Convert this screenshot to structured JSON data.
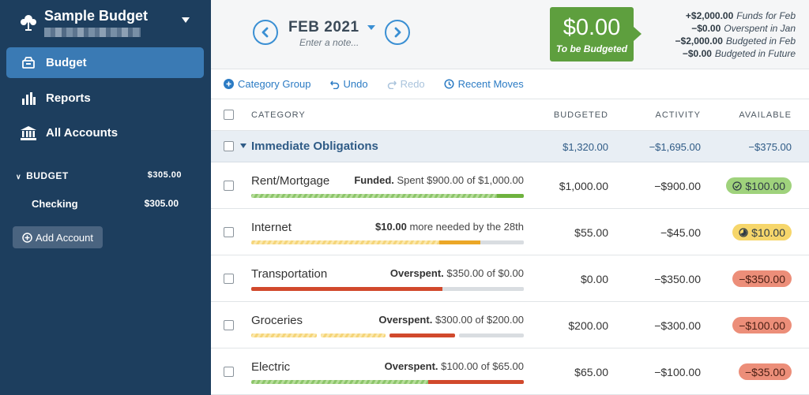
{
  "sidebar": {
    "budget_name": "Sample Budget",
    "nav": [
      {
        "label": "Budget",
        "icon": "budget-icon"
      },
      {
        "label": "Reports",
        "icon": "bar-chart-icon"
      },
      {
        "label": "All Accounts",
        "icon": "bank-icon"
      }
    ],
    "account_group": {
      "label": "BUDGET",
      "amount": "$305.00"
    },
    "accounts": [
      {
        "name": "Checking",
        "amount": "$305.00"
      }
    ],
    "add_account_label": "Add Account"
  },
  "header": {
    "month": "FEB 2021",
    "note_placeholder": "Enter a note...",
    "to_be_budgeted": {
      "amount": "$0.00",
      "label": "To be Budgeted"
    },
    "summary": [
      {
        "amount": "+$2,000.00",
        "label": "Funds for Feb"
      },
      {
        "amount": "−$0.00",
        "label": "Overspent in Jan"
      },
      {
        "amount": "−$2,000.00",
        "label": "Budgeted in Feb"
      },
      {
        "amount": "−$0.00",
        "label": "Budgeted in Future"
      }
    ]
  },
  "toolbar": {
    "category_group": "Category Group",
    "undo": "Undo",
    "redo": "Redo",
    "recent_moves": "Recent Moves"
  },
  "table": {
    "headers": {
      "category": "CATEGORY",
      "budgeted": "BUDGETED",
      "activity": "ACTIVITY",
      "available": "AVAILABLE"
    },
    "group": {
      "name": "Immediate Obligations",
      "budgeted": "$1,320.00",
      "activity": "−$1,695.00",
      "available": "−$375.00"
    },
    "rows": [
      {
        "name": "Rent/Mortgage",
        "status_bold": "Funded.",
        "status_text": "Spent $900.00 of $1,000.00",
        "budgeted": "$1,000.00",
        "activity": "−$900.00",
        "available": "$100.00",
        "available_state": "funded",
        "progress": 0.9
      },
      {
        "name": "Internet",
        "status_bold": "$10.00",
        "status_text": "more needed by the 28th",
        "budgeted": "$55.00",
        "activity": "−$45.00",
        "available": "$10.00",
        "available_state": "underfunded",
        "progress": 0.82
      },
      {
        "name": "Transportation",
        "status_bold": "Overspent.",
        "status_text": "$350.00 of $0.00",
        "budgeted": "$0.00",
        "activity": "−$350.00",
        "available": "−$350.00",
        "available_state": "overspent",
        "progress": 1.0
      },
      {
        "name": "Groceries",
        "status_bold": "Overspent.",
        "status_text": "$300.00 of $200.00",
        "budgeted": "$200.00",
        "activity": "−$300.00",
        "available": "−$100.00",
        "available_state": "overspent",
        "progress": 1.0
      },
      {
        "name": "Electric",
        "status_bold": "Overspent.",
        "status_text": "$100.00 of $65.00",
        "budgeted": "$65.00",
        "activity": "−$100.00",
        "available": "−$35.00",
        "available_state": "overspent",
        "progress": 1.0
      }
    ]
  },
  "colors": {
    "sidebar": "#1d3e5e",
    "accent": "#3a8fd3",
    "tbb_green": "#5e9f3e",
    "overspent": "#ec8e79",
    "funded": "#9fd27c",
    "underfunded": "#f6d66b"
  }
}
